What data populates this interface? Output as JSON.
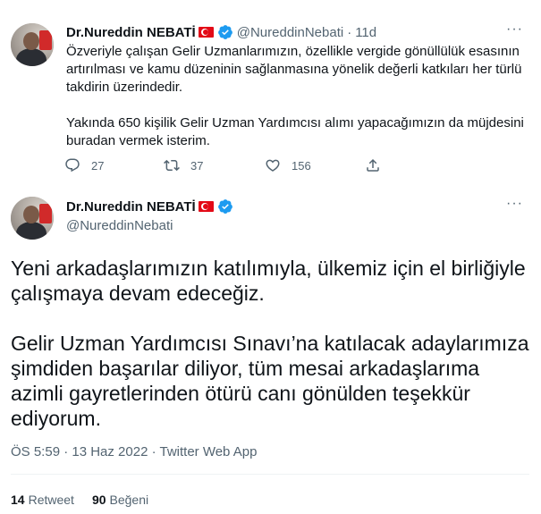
{
  "tweet1": {
    "author_name": "Dr.Nureddin NEBATİ",
    "handle": "@NureddinNebati",
    "separator": "·",
    "time": "11d",
    "more": "···",
    "text_para1": "Özveriyle çalışan Gelir Uzmanlarımızın, özellikle vergide gönüllülük esasının artırılması ve kamu düzeninin sağlanmasına yönelik değerli katkıları her türlü takdirin üzerindedir.",
    "text_para2": "Yakında 650 kişilik Gelir Uzman Yardımcısı alımı yapacağımızın da müjdesini buradan vermek isterim.",
    "reply_count": "27",
    "retweet_count": "37",
    "like_count": "156",
    "icons": {
      "reply": "reply-icon",
      "retweet": "retweet-icon",
      "like": "heart-icon",
      "share": "share-icon"
    }
  },
  "tweet2": {
    "author_name": "Dr.Nureddin NEBATİ",
    "handle": "@NureddinNebati",
    "more": "···",
    "text_para1": "Yeni arkadaşlarımızın katılımıyla, ülkemiz için el birliğiyle çalışmaya devam edeceğiz.",
    "text_para2": "Gelir Uzman Yardımcısı Sınavı’na katılacak adaylarımıza şimdiden başarılar diliyor, tüm mesai arkadaşlarıma azimli gayretlerinden ötürü canı gönülden teşekkür ediyorum.",
    "meta": "ÖS 5:59 · 13 Haz 2022 · Twitter Web App",
    "retweets_count": "14",
    "retweets_label": "Retweet",
    "likes_count": "90",
    "likes_label": "Beğeni"
  },
  "colors": {
    "text": "#0f1419",
    "secondary": "#536471",
    "verified": "#1d9bf0",
    "turkish_flag": "#e30a17"
  }
}
